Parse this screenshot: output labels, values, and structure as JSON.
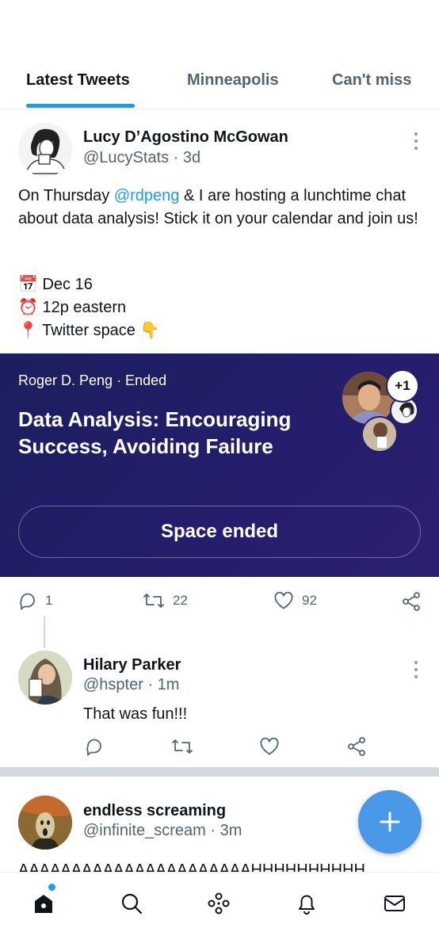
{
  "tabs": [
    {
      "label": "Latest Tweets",
      "active": true
    },
    {
      "label": "Minneapolis",
      "active": false
    },
    {
      "label": "Can't miss",
      "active": false
    }
  ],
  "tweet1": {
    "name": "Lucy D’Agostino McGowan",
    "handle": "@LucyStats · 3d",
    "text_before": "On Thursday ",
    "mention": "@rdpeng",
    "text_after": " & I are hosting a lunchtime chat about data analysis! Stick it on your calendar and join us!",
    "lines": [
      {
        "emoji": "📅",
        "text": "Dec 16"
      },
      {
        "emoji": "⏰",
        "text": "12p eastern"
      },
      {
        "emoji": "📍",
        "text": "Twitter space 👇"
      }
    ],
    "space": {
      "meta": "Roger D. Peng · Ended",
      "title": "Data Analysis: Encouraging Success, Avoiding Failure",
      "extra_listeners": "+1",
      "button_label": "Space ended"
    },
    "actions": {
      "replies": "1",
      "retweets": "22",
      "likes": "92"
    }
  },
  "tweet2": {
    "name": "Hilary Parker",
    "handle": "@hspter · 1m",
    "text": "That was fun!!!"
  },
  "tweet3": {
    "name": "endless screaming",
    "handle": "@infinite_scream · 3m",
    "text": "AAAAAAAAAAAAAAAAAAAAAAHHHHHHHHHH"
  },
  "colors": {
    "accent": "#1d9bf0",
    "space_bg": "#241e6b",
    "fab": "#4a99e9"
  },
  "nav": [
    {
      "icon": "home-icon",
      "has_notification": true
    },
    {
      "icon": "search-icon"
    },
    {
      "icon": "spaces-icon"
    },
    {
      "icon": "bell-icon"
    },
    {
      "icon": "mail-icon"
    }
  ]
}
